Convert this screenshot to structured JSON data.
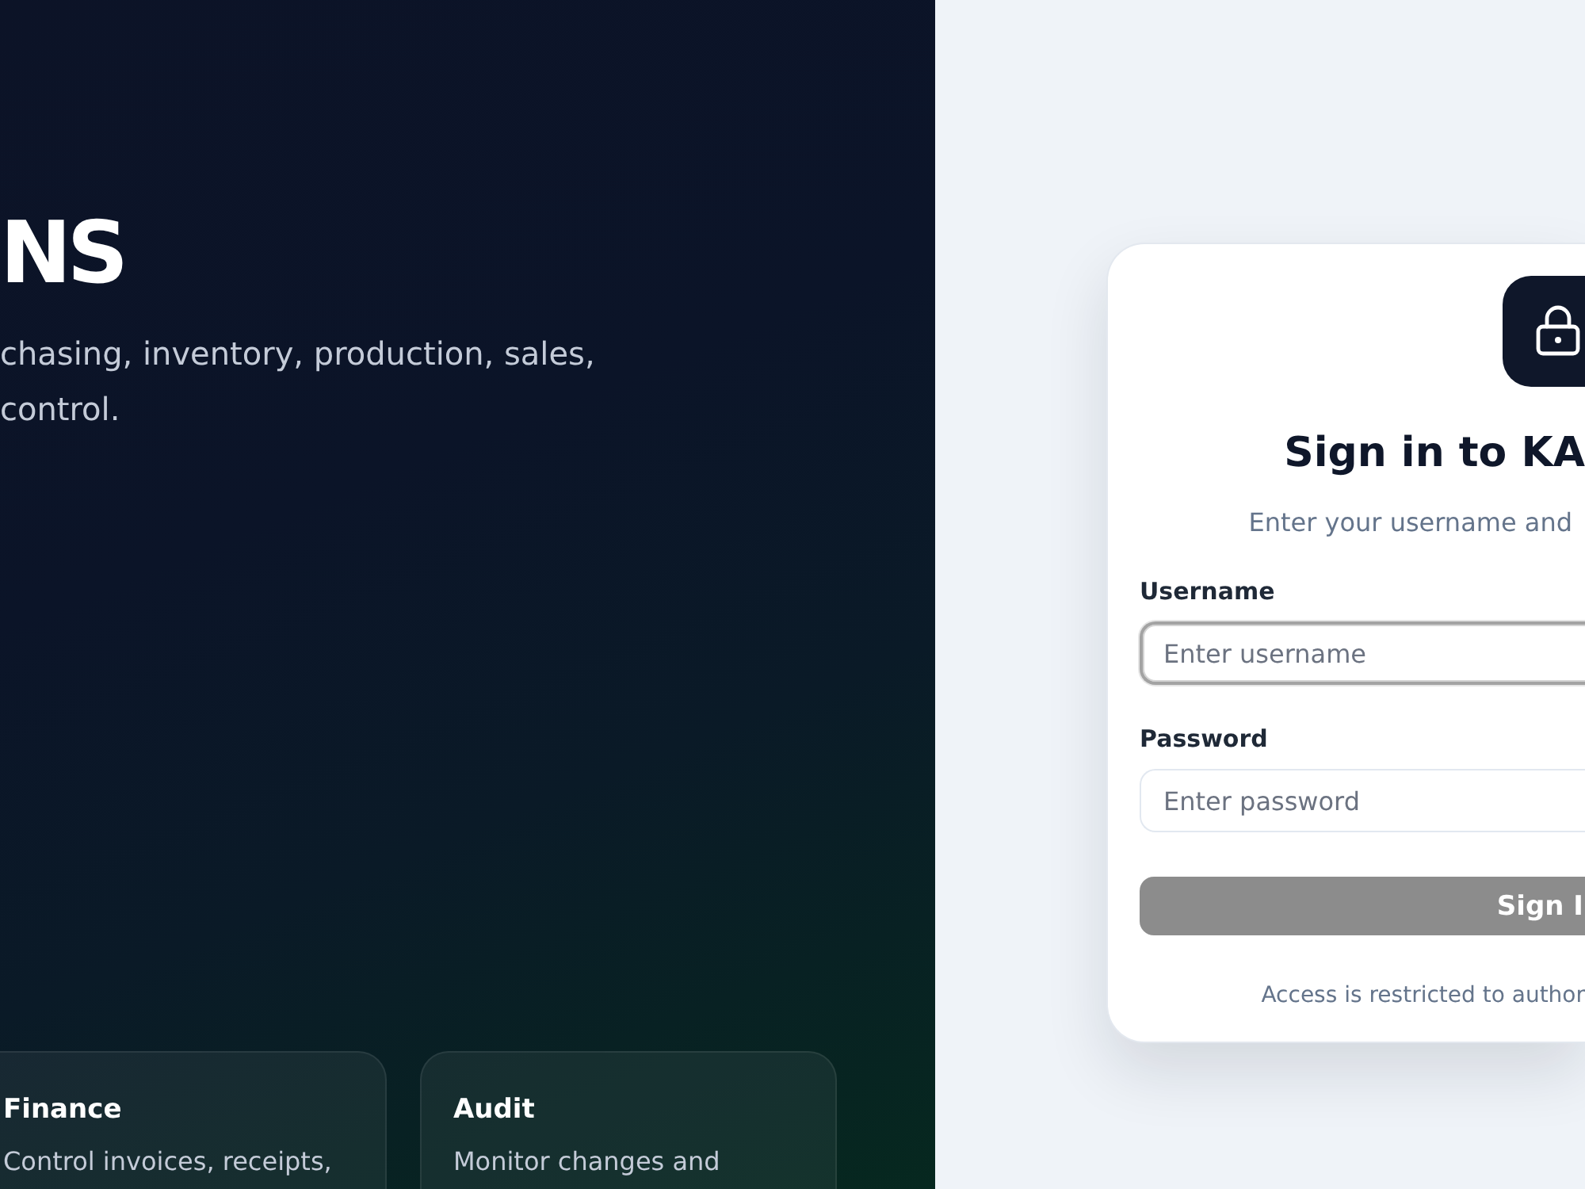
{
  "hero": {
    "title": "NS",
    "description_lines": [
      "chasing, inventory, production, sales,",
      "control."
    ]
  },
  "features": [
    {
      "title": "Finance",
      "description": "Control invoices, receipts,"
    },
    {
      "title": "Audit",
      "description": "Monitor changes and"
    }
  ],
  "login": {
    "title": "Sign in to KA",
    "subtitle": "Enter your username and",
    "fields": [
      {
        "label": "Username",
        "placeholder": "Enter username",
        "focused": true
      },
      {
        "label": "Password",
        "placeholder": "Enter password",
        "focused": false
      }
    ],
    "submit": {
      "label": "Sign I",
      "disabled": true
    },
    "note": "Access is restricted to author"
  }
}
